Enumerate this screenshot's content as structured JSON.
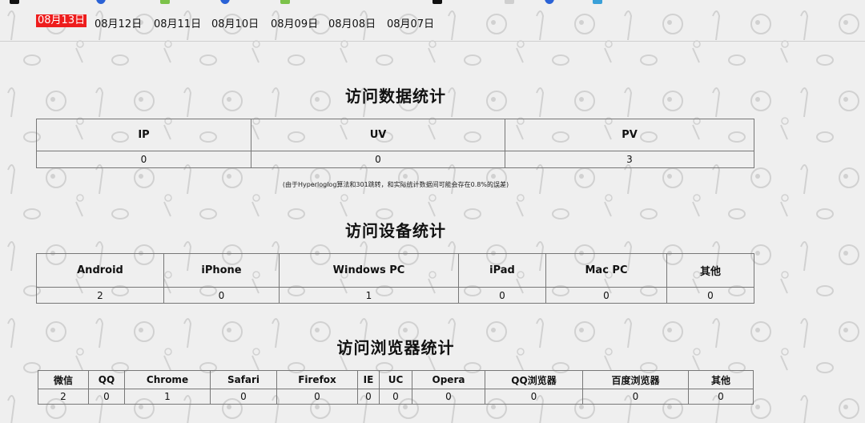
{
  "dates": {
    "items": [
      "08月13日",
      "08月12日",
      "08月11日",
      "08月10日",
      "08月09日",
      "08月08日",
      "08月07日"
    ],
    "active_index": 0
  },
  "traffic": {
    "title": "访问数据统计",
    "headers": [
      "IP",
      "UV",
      "PV"
    ],
    "values": [
      "0",
      "0",
      "3"
    ],
    "note": "(由于Hyperloglog算法和301跳转，和实际统计数据间可能会存在0.8%的误差)"
  },
  "devices": {
    "title": "访问设备统计",
    "headers": [
      "Android",
      "iPhone",
      "Windows PC",
      "iPad",
      "Mac PC",
      "其他"
    ],
    "values": [
      "2",
      "0",
      "1",
      "0",
      "0",
      "0"
    ]
  },
  "browsers": {
    "title": "访问浏览器统计",
    "headers": [
      "微信",
      "QQ",
      "Chrome",
      "Safari",
      "Firefox",
      "IE",
      "UC",
      "Opera",
      "QQ浏览器",
      "百度浏览器",
      "其他"
    ],
    "values": [
      "2",
      "0",
      "1",
      "0",
      "0",
      "0",
      "0",
      "0",
      "0",
      "0",
      "0"
    ]
  },
  "colors": {
    "accent": "#ee1d1d",
    "background": "#efefef",
    "border": "#777777"
  }
}
